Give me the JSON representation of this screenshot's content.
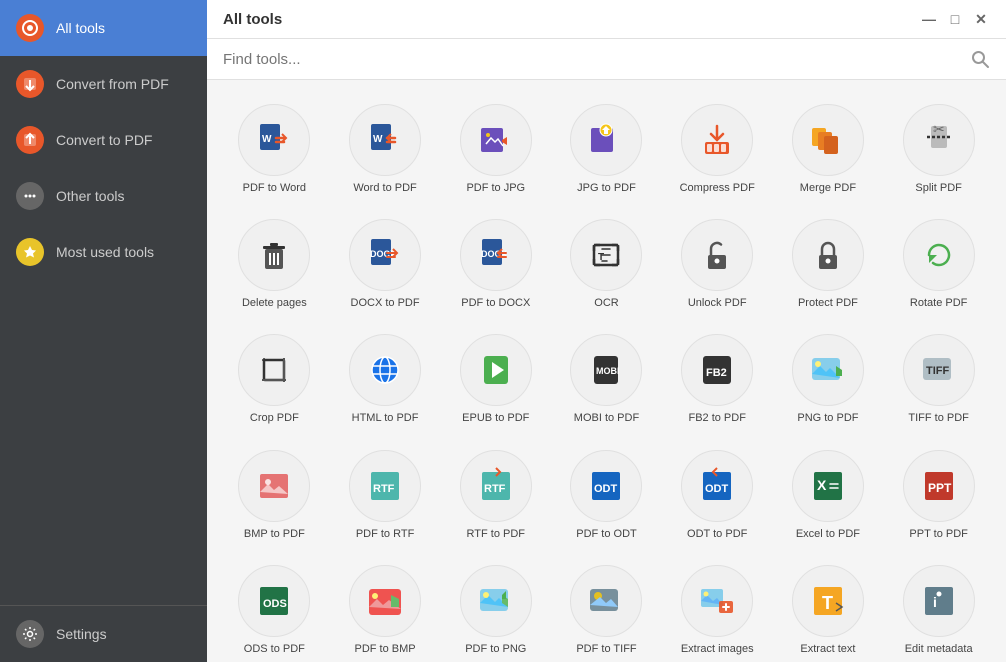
{
  "app": {
    "title": "All tools",
    "window_controls": [
      "minimize",
      "maximize",
      "close"
    ]
  },
  "sidebar": {
    "items": [
      {
        "id": "all-tools",
        "label": "All tools",
        "active": true
      },
      {
        "id": "convert-from-pdf",
        "label": "Convert from PDF",
        "active": false
      },
      {
        "id": "convert-to-pdf",
        "label": "Convert to PDF",
        "active": false
      },
      {
        "id": "other-tools",
        "label": "Other tools",
        "active": false
      },
      {
        "id": "most-used-tools",
        "label": "Most used tools",
        "active": false
      }
    ],
    "bottom": {
      "id": "settings",
      "label": "Settings"
    }
  },
  "search": {
    "placeholder": "Find tools..."
  },
  "tools": [
    {
      "id": "pdf-to-word",
      "label": "PDF to Word"
    },
    {
      "id": "word-to-pdf",
      "label": "Word to PDF"
    },
    {
      "id": "pdf-to-jpg",
      "label": "PDF to JPG"
    },
    {
      "id": "jpg-to-pdf",
      "label": "JPG to PDF"
    },
    {
      "id": "compress-pdf",
      "label": "Compress PDF"
    },
    {
      "id": "merge-pdf",
      "label": "Merge PDF"
    },
    {
      "id": "split-pdf",
      "label": "Split PDF"
    },
    {
      "id": "delete-pages",
      "label": "Delete pages"
    },
    {
      "id": "docx-to-pdf",
      "label": "DOCX to PDF"
    },
    {
      "id": "pdf-to-docx",
      "label": "PDF to DOCX"
    },
    {
      "id": "ocr",
      "label": "OCR"
    },
    {
      "id": "unlock-pdf",
      "label": "Unlock PDF"
    },
    {
      "id": "protect-pdf",
      "label": "Protect PDF"
    },
    {
      "id": "rotate-pdf",
      "label": "Rotate PDF"
    },
    {
      "id": "crop-pdf",
      "label": "Crop PDF"
    },
    {
      "id": "html-to-pdf",
      "label": "HTML to PDF"
    },
    {
      "id": "epub-to-pdf",
      "label": "EPUB to PDF"
    },
    {
      "id": "mobi-to-pdf",
      "label": "MOBI to PDF"
    },
    {
      "id": "fb2-to-pdf",
      "label": "FB2 to PDF"
    },
    {
      "id": "png-to-pdf",
      "label": "PNG to PDF"
    },
    {
      "id": "tiff-to-pdf",
      "label": "TIFF to PDF"
    },
    {
      "id": "bmp-to-pdf",
      "label": "BMP to PDF"
    },
    {
      "id": "pdf-to-rtf",
      "label": "PDF to RTF"
    },
    {
      "id": "rtf-to-pdf",
      "label": "RTF to PDF"
    },
    {
      "id": "pdf-to-odt",
      "label": "PDF to ODT"
    },
    {
      "id": "odt-to-pdf",
      "label": "ODT to PDF"
    },
    {
      "id": "excel-to-pdf",
      "label": "Excel to PDF"
    },
    {
      "id": "ppt-to-pdf",
      "label": "PPT to PDF"
    },
    {
      "id": "ods-to-pdf",
      "label": "ODS to PDF"
    },
    {
      "id": "pdf-to-bmp",
      "label": "PDF to BMP"
    },
    {
      "id": "pdf-to-png",
      "label": "PDF to PNG"
    },
    {
      "id": "pdf-to-tiff",
      "label": "PDF to TIFF"
    },
    {
      "id": "extract-images",
      "label": "Extract images"
    },
    {
      "id": "extract-text",
      "label": "Extract text"
    },
    {
      "id": "edit-metadata",
      "label": "Edit metadata"
    }
  ]
}
